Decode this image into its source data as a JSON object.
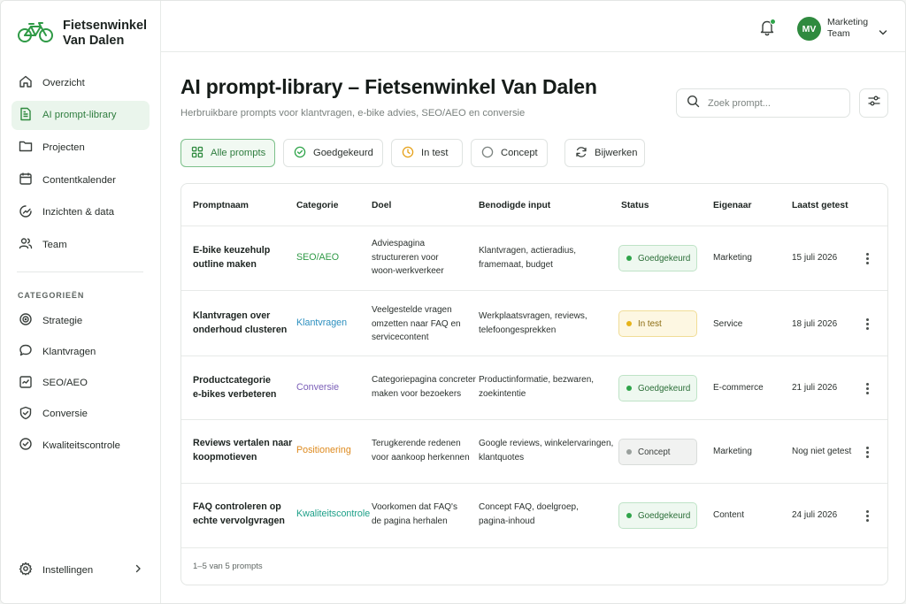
{
  "brand": {
    "name_line1": "Fietsenwinkel",
    "name_line2": "Van Dalen"
  },
  "colors": {
    "accent": "#2f8a3f",
    "approved": "#2fa44a",
    "testing": "#e6b319",
    "concept": "#9aa09d",
    "seo": "#2f9a46",
    "klantvragen": "#2b8fbf",
    "conversie": "#7b5fb8",
    "positionering": "#de8a1e",
    "kwaliteit": "#1b9f87"
  },
  "sidebar": {
    "nav": [
      {
        "label": "Overzicht",
        "icon": "home-icon"
      },
      {
        "label": "AI prompt-library",
        "icon": "document-icon",
        "active": true
      },
      {
        "label": "Projecten",
        "icon": "folder-icon"
      },
      {
        "label": "Contentkalender",
        "icon": "calendar-icon"
      },
      {
        "label": "Inzichten & data",
        "icon": "chart-icon"
      },
      {
        "label": "Team",
        "icon": "users-icon"
      }
    ],
    "categories_title": "CATEGORIEËN",
    "categories": [
      {
        "label": "Strategie",
        "icon": "target-icon"
      },
      {
        "label": "Klantvragen",
        "icon": "chat-icon"
      },
      {
        "label": "SEO/AEO",
        "icon": "seo-icon"
      },
      {
        "label": "Conversie",
        "icon": "shield-check-icon"
      },
      {
        "label": "Kwaliteitscontrole",
        "icon": "check-circle-icon"
      }
    ],
    "settings_label": "Instellingen"
  },
  "topbar": {
    "avatar_initials": "MV",
    "user_line1": "Marketing",
    "user_line2": "Team"
  },
  "page": {
    "title": "AI prompt-library – Fietsenwinkel Van Dalen",
    "subtitle": "Herbruikbare prompts voor klantvragen, e-bike advies, SEO/AEO en conversie",
    "search_placeholder": "Zoek prompt..."
  },
  "filters": [
    {
      "label": "Alle prompts",
      "icon": "grid-icon",
      "active": true
    },
    {
      "label": "Goedgekeurd",
      "icon": "check-circle-icon"
    },
    {
      "label": "In test",
      "icon": "clock-icon"
    },
    {
      "label": "Concept",
      "icon": "circle-icon"
    },
    {
      "label": "Bijwerken",
      "icon": "refresh-icon"
    }
  ],
  "table": {
    "columns": [
      "Promptnaam",
      "Categorie",
      "Doel",
      "Benodigde input",
      "Status",
      "Eigenaar",
      "Laatst getest"
    ],
    "rows": [
      {
        "name": [
          "E-bike keuzehulp",
          "outline maken"
        ],
        "category": "SEO/AEO",
        "goal": [
          "Adviespagina",
          "structureren voor",
          "woon-werkverkeer"
        ],
        "input": [
          "Klantvragen, actieradius,",
          "framemaat, budget"
        ],
        "status": "Goedgekeurd",
        "owner": "Marketing",
        "tested": "15 juli 2026"
      },
      {
        "name": [
          "Klantvragen over",
          "onderhoud clusteren"
        ],
        "category": "Klantvragen",
        "goal": [
          "Veelgestelde vragen",
          "omzetten naar FAQ en",
          "servicecontent"
        ],
        "input": [
          "Werkplaatsvragen, reviews,",
          "telefoongesprekken"
        ],
        "status": "In test",
        "owner": "Service",
        "tested": "18 juli 2026"
      },
      {
        "name": [
          "Productcategorie",
          "e-bikes verbeteren"
        ],
        "category": "Conversie",
        "goal": [
          "Categoriepagina concreter",
          "maken voor bezoekers"
        ],
        "input": [
          "Productinformatie, bezwaren,",
          "zoekintentie"
        ],
        "status": "Goedgekeurd",
        "owner": "E-commerce",
        "tested": "21 juli 2026"
      },
      {
        "name": [
          "Reviews vertalen naar",
          "koopmotieven"
        ],
        "category": "Positionering",
        "goal": [
          "Terugkerende redenen",
          "voor aankoop herkennen"
        ],
        "input": [
          "Google reviews, winkelervaringen,",
          "klantquotes"
        ],
        "status": "Concept",
        "owner": "Marketing",
        "tested": "Nog niet getest"
      },
      {
        "name": [
          "FAQ controleren op",
          "echte vervolgvragen"
        ],
        "category": "Kwaliteitscontrole",
        "goal": [
          "Voorkomen dat FAQ's",
          "de pagina herhalen"
        ],
        "input": [
          "Concept FAQ, doelgroep,",
          "pagina-inhoud"
        ],
        "status": "Goedgekeurd",
        "owner": "Content",
        "tested": "24 juli 2026"
      }
    ],
    "footer": "1–5 van 5 prompts"
  }
}
